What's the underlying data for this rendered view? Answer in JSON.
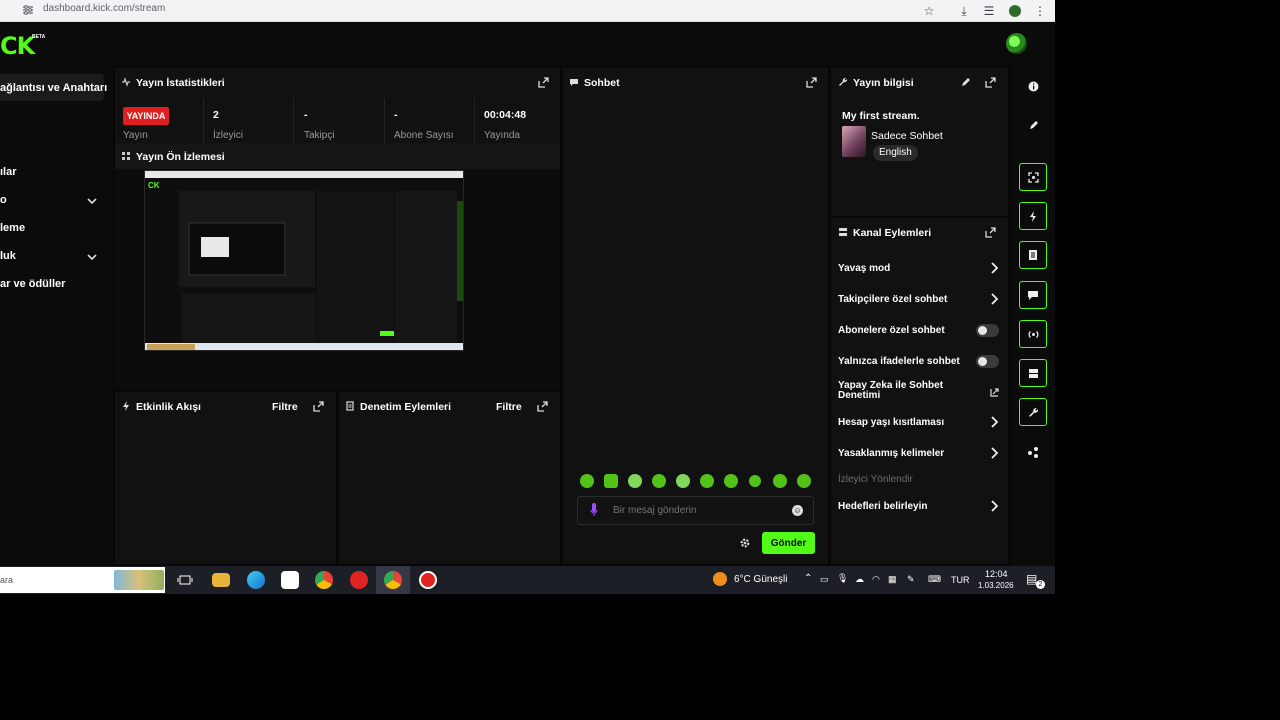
{
  "browser": {
    "url": "dashboard.kick.com/stream"
  },
  "brand": {
    "logo": "CK",
    "badge": "BETA",
    "accent": "#53fc18"
  },
  "sidebar": {
    "items": [
      {
        "label": "ağlantısı ve Anahtarı",
        "selected": true
      },
      {
        "label": "ılar"
      },
      {
        "label": "o",
        "has_chevron": true
      },
      {
        "label": "leme"
      },
      {
        "label": "luk",
        "has_chevron": true
      },
      {
        "label": "ar ve ödüller"
      }
    ]
  },
  "stats_panel": {
    "title": "Yayın İstatistikleri",
    "live_label": "YAYINDA",
    "live_partial_label": "Yayın",
    "stats": [
      {
        "value": "2",
        "label": "İzleyici"
      },
      {
        "value": "-",
        "label": "Takipçi"
      },
      {
        "value": "-",
        "label": "Abone Sayısı"
      },
      {
        "value": "00:04:48",
        "label": "Yayında"
      }
    ]
  },
  "preview_panel": {
    "title": "Yayın Ön İzlemesi"
  },
  "activity_panel": {
    "title": "Etkinlik Akışı",
    "filter": "Filtre"
  },
  "moderation_panel": {
    "title": "Denetim Eylemleri",
    "filter": "Filtre"
  },
  "chat": {
    "title": "Sohbet",
    "input_placeholder": "Bir mesaj gönderin",
    "send_label": "Gönder"
  },
  "stream_info": {
    "title": "Yayın bilgisi",
    "stream_title": "My first stream.",
    "category": "Sadece Sohbet",
    "language": "English"
  },
  "channel_actions": {
    "title": "Kanal Eylemleri",
    "items": [
      {
        "label": "Yavaş mod",
        "control": "arrow"
      },
      {
        "label": "Takipçilere özel sohbet",
        "control": "arrow"
      },
      {
        "label": "Abonelere özel sohbet",
        "control": "toggle",
        "enabled": false
      },
      {
        "label": "Yalnızca ifadelerle sohbet",
        "control": "toggle",
        "enabled": false
      },
      {
        "label": "Yapay Zeka ile Sohbet Denetimi",
        "control": "external"
      },
      {
        "label": "Hesap yaşı kısıtlaması",
        "control": "arrow"
      },
      {
        "label": "Yasaklanmış kelimeler",
        "control": "arrow"
      },
      {
        "label": "İzleyici Yönlendir",
        "control": "none",
        "disabled": true
      },
      {
        "label": "Hedefleri belirleyin",
        "control": "arrow"
      }
    ]
  },
  "rail_icons": [
    "info-icon",
    "edit-icon",
    "focus-icon",
    "bolt-icon",
    "document-icon",
    "chat-icon",
    "broadcast-icon",
    "layout-icon",
    "wrench-icon",
    "share-icon"
  ],
  "taskbar": {
    "search_text": "ara",
    "weather": "6°C Güneşli",
    "language": "TUR",
    "time": "12:04",
    "date": "1.03.2026",
    "notifications": "2"
  }
}
